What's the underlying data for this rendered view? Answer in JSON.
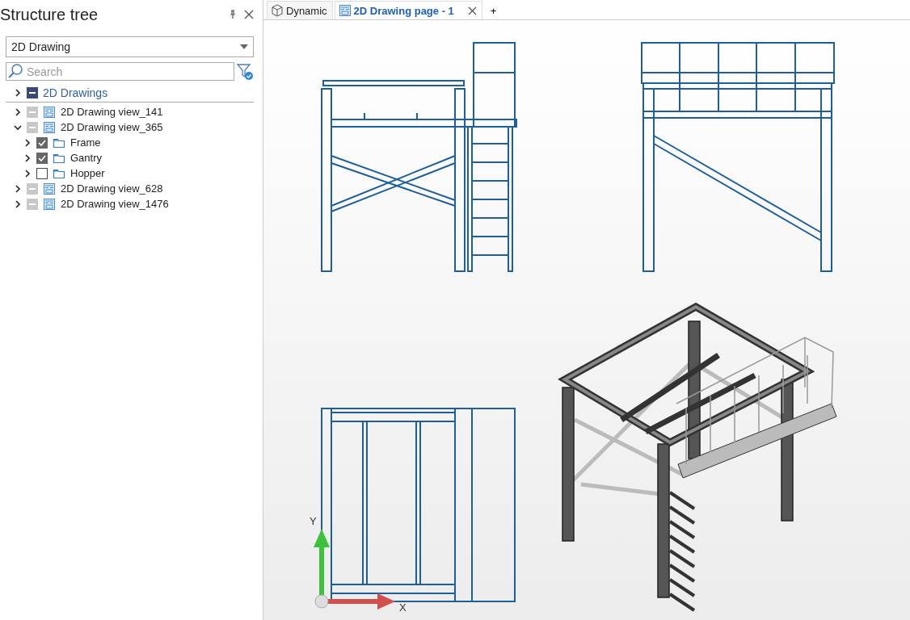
{
  "sidebar": {
    "title": "Structure tree",
    "dropdown": {
      "value": "2D Drawing"
    },
    "search": {
      "placeholder": "Search"
    },
    "tree": [
      {
        "label": "2D Drawings",
        "kind": "root",
        "expanded": false,
        "checked": false,
        "mixed": true,
        "disabled": false
      },
      {
        "label": "2D Drawing view_141",
        "kind": "view",
        "expanded": false,
        "checked": false,
        "mixed": true,
        "disabled": true
      },
      {
        "label": "2D Drawing view_365",
        "kind": "view",
        "expanded": true,
        "checked": false,
        "mixed": true,
        "disabled": true,
        "children": [
          {
            "label": "Frame",
            "kind": "folder",
            "expanded": false,
            "checked": true,
            "mixed": false,
            "disabled": false
          },
          {
            "label": "Gantry",
            "kind": "folder",
            "expanded": false,
            "checked": true,
            "mixed": false,
            "disabled": false
          },
          {
            "label": "Hopper",
            "kind": "folder",
            "expanded": false,
            "checked": false,
            "mixed": false,
            "disabled": false
          }
        ]
      },
      {
        "label": "2D Drawing view_628",
        "kind": "view",
        "expanded": false,
        "checked": false,
        "mixed": true,
        "disabled": true
      },
      {
        "label": "2D Drawing view_1476",
        "kind": "view",
        "expanded": false,
        "checked": false,
        "mixed": true,
        "disabled": true
      }
    ]
  },
  "tabs": [
    {
      "label": "Dynamic",
      "kind": "model",
      "selected": false,
      "closable": false
    },
    {
      "label": "2D Drawing page - 1",
      "kind": "drawing",
      "selected": true,
      "closable": true
    }
  ],
  "add_tab": "+",
  "canvas": {
    "axes": {
      "x": "X",
      "y": "Y"
    }
  }
}
